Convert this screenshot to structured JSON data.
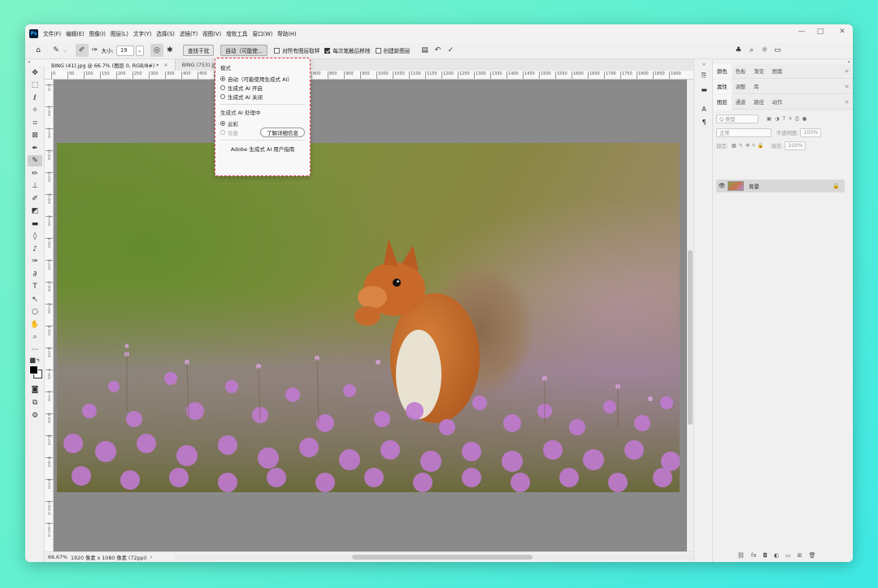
{
  "menubar": {
    "logo": "Ps",
    "items": [
      "文件(F)",
      "编辑(E)",
      "图像(I)",
      "图层(L)",
      "文字(Y)",
      "选择(S)",
      "滤镜(T)",
      "视图(V)",
      "增效工具",
      "窗口(W)",
      "帮助(H)"
    ],
    "minimize": "—",
    "maximize": "□",
    "close": "✕"
  },
  "options": {
    "size_label": "大小:",
    "size_value": "19",
    "find_distractions": "查找干扰",
    "mode_button": "自动（可能使...",
    "sample_all_layers": "对所有图层取样",
    "remove_after_stroke": "每次笔触后移除",
    "create_new_layer": "创建新图层"
  },
  "tabs": [
    {
      "label": "BING (41).jpg @ 66.7% (图层 0, RGB/8#) *"
    },
    {
      "label": "BING (753).jpg"
    }
  ],
  "tab_close": "×",
  "ruler_top": [
    "0",
    "50",
    "100",
    "150",
    "200",
    "250",
    "300",
    "350",
    "400",
    "450",
    "500",
    "550",
    "600",
    "650",
    "700",
    "750",
    "800",
    "850",
    "900",
    "950",
    "1000",
    "1050",
    "1100",
    "1150",
    "1200",
    "1250",
    "1300",
    "1350",
    "1400",
    "1450",
    "1500",
    "1550",
    "1600",
    "1650",
    "1700",
    "1750",
    "1800",
    "1850",
    "1900"
  ],
  "ruler_left": [
    "50",
    "100",
    "150",
    "200",
    "250",
    "300",
    "350",
    "400",
    "450",
    "500",
    "550",
    "600",
    "650",
    "700",
    "750",
    "800",
    "850",
    "900",
    "950",
    "1000",
    "1050"
  ],
  "popup": {
    "mode_title": "模式",
    "options": [
      "自动（可能使用生成式 AI）",
      "生成式 AI 开启",
      "生成式 AI 关闭"
    ],
    "selected_index": 0,
    "processing_title": "生成式 AI 处理中",
    "cloud": "云彩",
    "device": "设备",
    "learn_more": "了解详细信息",
    "guide": "Adobe 生成式 AI 用户指南"
  },
  "status": {
    "zoom": "66.67%",
    "info": "1920 像素 x 1080 像素 (72ppi)",
    "arrow": "›"
  },
  "panels": {
    "group1": [
      "颜色",
      "色板",
      "渐变",
      "图案"
    ],
    "group2": [
      "属性",
      "调整",
      "库"
    ],
    "group3": [
      "图层",
      "通道",
      "路径",
      "动作"
    ],
    "kind_label": "Q 类型",
    "blend_mode": "正常",
    "opacity_label": "不透明度:",
    "opacity_value": "100%",
    "lock_label": "锁定:",
    "fill_label": "填充:",
    "fill_value": "100%",
    "layer_name": "背景"
  },
  "colors": {
    "accent_dashed": "#e0334a",
    "canvas_bg": "#8a8a8a"
  }
}
